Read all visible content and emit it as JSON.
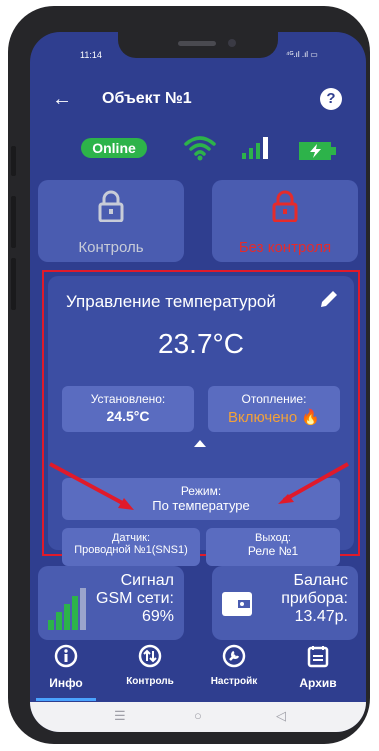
{
  "status_bar": {
    "time": "11:14",
    "right_icons": "⁴ᴳ.ıl .ıl ▭"
  },
  "app_bar": {
    "back_icon": "arrow-left-icon",
    "title": "Объект №1",
    "help_label": "?"
  },
  "connection": {
    "online_label": "Online",
    "wifi_icon": "wifi-icon",
    "signal_icon": "signal-bars-icon",
    "battery_icon": "battery-charging-icon"
  },
  "guard": {
    "control_label": "Контроль",
    "no_control_label": "Без контроля",
    "control_color": "#c8ccd8",
    "no_control_color": "#e52b2b"
  },
  "temperature_panel": {
    "title": "Управление температурой",
    "current_temp": "23.7°C",
    "set_label": "Установлено:",
    "set_value": "24.5°C",
    "heating_label": "Отопление:",
    "heating_value": "Включено",
    "heating_color": "#f2a13a",
    "mode_label": "Режим:",
    "mode_value": "По температуре",
    "sensor_label": "Датчик:",
    "sensor_value": "Проводной №1(SNS1)",
    "output_label": "Выход:",
    "output_value": "Реле №1"
  },
  "tiles": {
    "gsm_line1": "Сигнал",
    "gsm_line2": "GSM сети:",
    "gsm_value": "69%",
    "balance_line1": "Баланс",
    "balance_line2": "прибора:",
    "balance_value": "13.47р."
  },
  "bottom_nav": {
    "info_label": "Инфо",
    "control_label": "Контроль",
    "settings_label": "Настройк",
    "archive_label": "Архив"
  },
  "system_nav": {
    "recent": "☰",
    "home": "○",
    "back": "◁"
  },
  "colors": {
    "background": "#2f3e8f",
    "highlight": "#e01a2a",
    "online": "#2db34a"
  }
}
